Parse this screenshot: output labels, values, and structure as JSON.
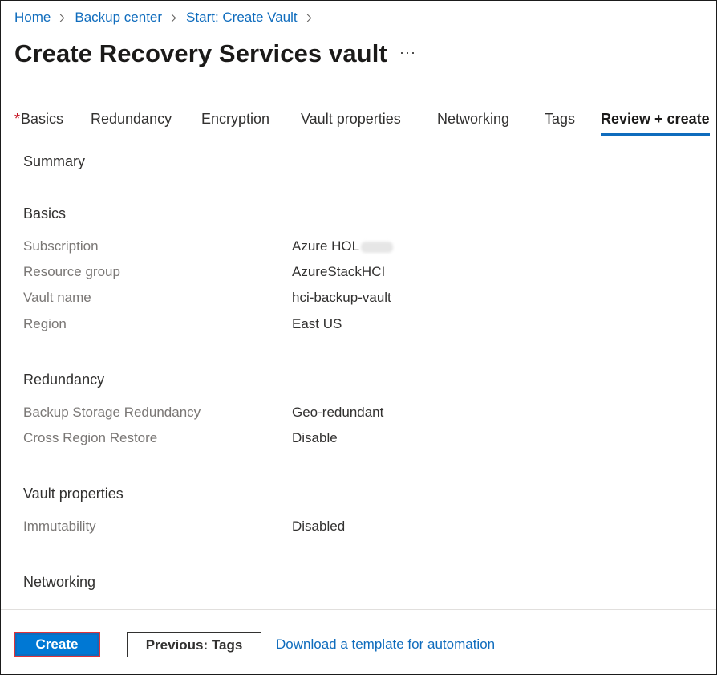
{
  "breadcrumb": [
    "Home",
    "Backup center",
    "Start: Create Vault"
  ],
  "title": "Create Recovery Services vault",
  "more_label": "···",
  "tabs": {
    "required_marker": "*",
    "items": [
      "Basics",
      "Redundancy",
      "Encryption",
      "Vault properties",
      "Networking",
      "Tags",
      "Review + create"
    ],
    "active": "Review + create"
  },
  "summary": {
    "heading": "Summary",
    "basics": {
      "heading": "Basics",
      "rows": [
        {
          "label": "Subscription",
          "value": "Azure HOL"
        },
        {
          "label": "Resource group",
          "value": "AzureStackHCI"
        },
        {
          "label": "Vault name",
          "value": "hci-backup-vault"
        },
        {
          "label": "Region",
          "value": "East US"
        }
      ]
    },
    "redundancy": {
      "heading": "Redundancy",
      "rows": [
        {
          "label": "Backup Storage Redundancy",
          "value": "Geo-redundant"
        },
        {
          "label": "Cross Region Restore",
          "value": "Disable"
        }
      ]
    },
    "vault_properties": {
      "heading": "Vault properties",
      "rows": [
        {
          "label": "Immutability",
          "value": "Disabled"
        }
      ]
    },
    "networking": {
      "heading": "Networking"
    }
  },
  "footer": {
    "create_label": "Create",
    "previous_label": "Previous: Tags",
    "template_link": "Download a template for automation"
  },
  "colors": {
    "accent": "#0f6cbd",
    "primary_button": "#0078d4",
    "required": "#c50f1f",
    "highlight_border": "#e0343a"
  }
}
